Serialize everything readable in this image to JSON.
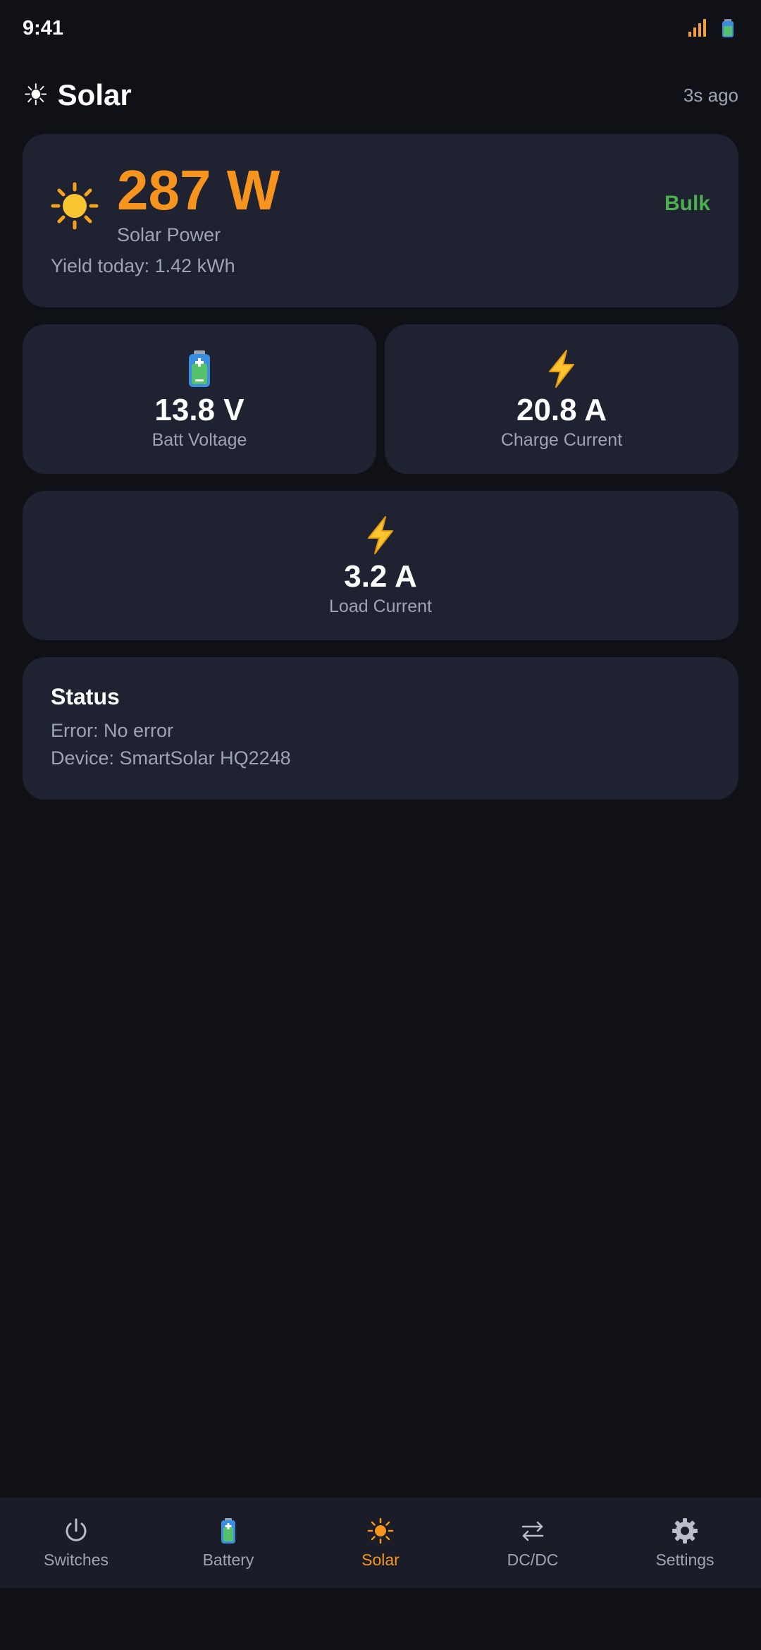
{
  "status_bar": {
    "time": "9:41"
  },
  "header": {
    "title": "Solar",
    "title_icon": "sun-icon",
    "updated": "3s ago"
  },
  "solar": {
    "power": "287 W",
    "power_label": "Solar Power",
    "state": "Bulk",
    "yield": "Yield today: 1.42 kWh"
  },
  "metrics": {
    "batt_voltage": {
      "value": "13.8 V",
      "label": "Batt Voltage",
      "icon": "battery-icon"
    },
    "charge_current": {
      "value": "20.8 A",
      "label": "Charge Current",
      "icon": "lightning-icon"
    },
    "load_current": {
      "value": "3.2 A",
      "label": "Load Current",
      "icon": "lightning-icon"
    }
  },
  "status": {
    "title": "Status",
    "error": "Error: No error",
    "device": "Device: SmartSolar HQ2248"
  },
  "nav": {
    "items": [
      {
        "label": "Switches",
        "icon": "power-icon"
      },
      {
        "label": "Battery",
        "icon": "battery-icon"
      },
      {
        "label": "Solar",
        "icon": "sun-icon",
        "active": true
      },
      {
        "label": "DC/DC",
        "icon": "swap-arrows-icon"
      },
      {
        "label": "Settings",
        "icon": "gear-icon"
      }
    ]
  },
  "colors": {
    "background": "#101116",
    "card": "#1f2231",
    "accent": "#f7941d",
    "state_green": "#4caf50",
    "muted_text": "#9ea4b3"
  }
}
